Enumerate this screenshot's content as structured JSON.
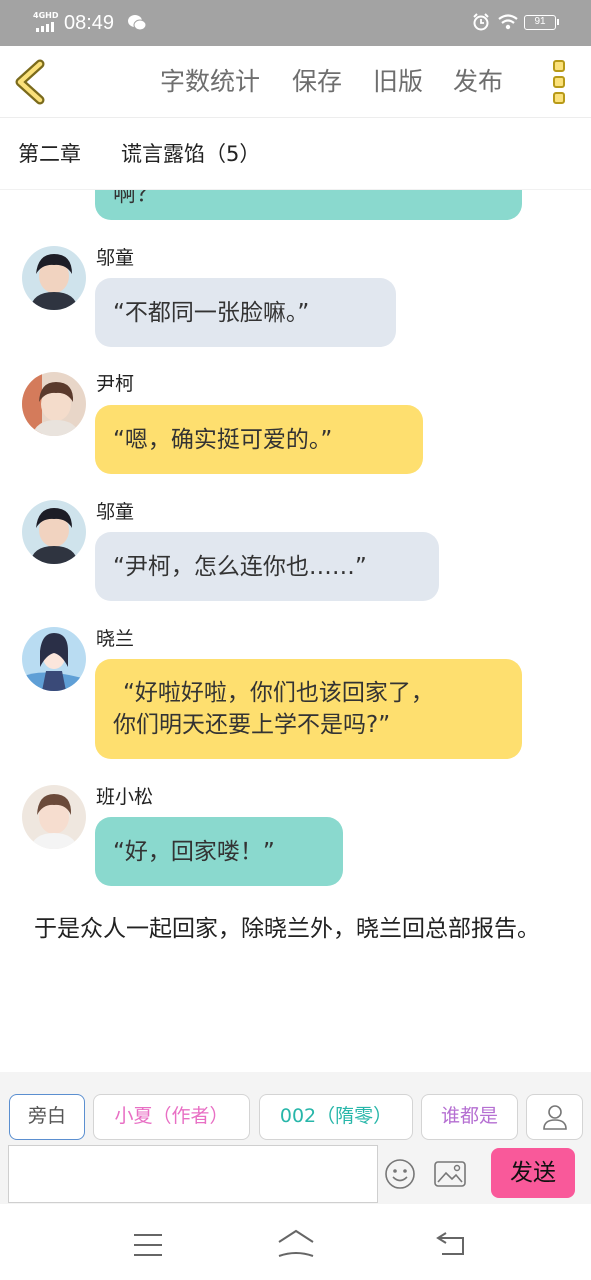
{
  "status_bar": {
    "network": "4GHD",
    "time": "08:49",
    "battery": "91"
  },
  "toolbar": {
    "word_count": "字数统计",
    "save": "保存",
    "old_version": "旧版",
    "publish": "发布"
  },
  "chapter": {
    "number": "第二章",
    "title": "谎言露馅（5）"
  },
  "chat": {
    "top_partial_bubble": "啊？",
    "messages": [
      {
        "sender": "邬童",
        "text": "“不都同一张脸嘛。”"
      },
      {
        "sender": "尹柯",
        "text": "“嗯，确实挺可爱的。”"
      },
      {
        "sender": "邬童",
        "text": "“尹柯，怎么连你也……”"
      },
      {
        "sender": "晓兰",
        "line1": "“好啦好啦，你们也该回家了，",
        "line2": "你们明天还要上学不是吗?”"
      },
      {
        "sender": "班小松",
        "text": "“好，回家喽！”"
      }
    ],
    "narration": "于是众人一起回家，除晓兰外，晓兰回总部报告。"
  },
  "roles": {
    "narrator": "旁白",
    "author": "小夏（作者）",
    "role_002": "002（隋零）",
    "anyone": "谁都是"
  },
  "composer": {
    "input_value": "",
    "send": "发送"
  },
  "colors": {
    "status_bar": "#a3a3a3",
    "teal_bubble": "#8ad9ce",
    "gray_bubble": "#e1e7ef",
    "yellow_bubble": "#fedf6f",
    "send_button": "#f9599a",
    "accent_yellow": "#fbe17a"
  },
  "icons": {
    "back": "chevron-left-icon",
    "more": "more-vertical-icon",
    "person": "person-icon",
    "emoji": "emoji-icon",
    "image": "image-icon",
    "nav_menu": "menu-icon",
    "nav_home": "home-icon",
    "nav_back": "back-icon"
  }
}
